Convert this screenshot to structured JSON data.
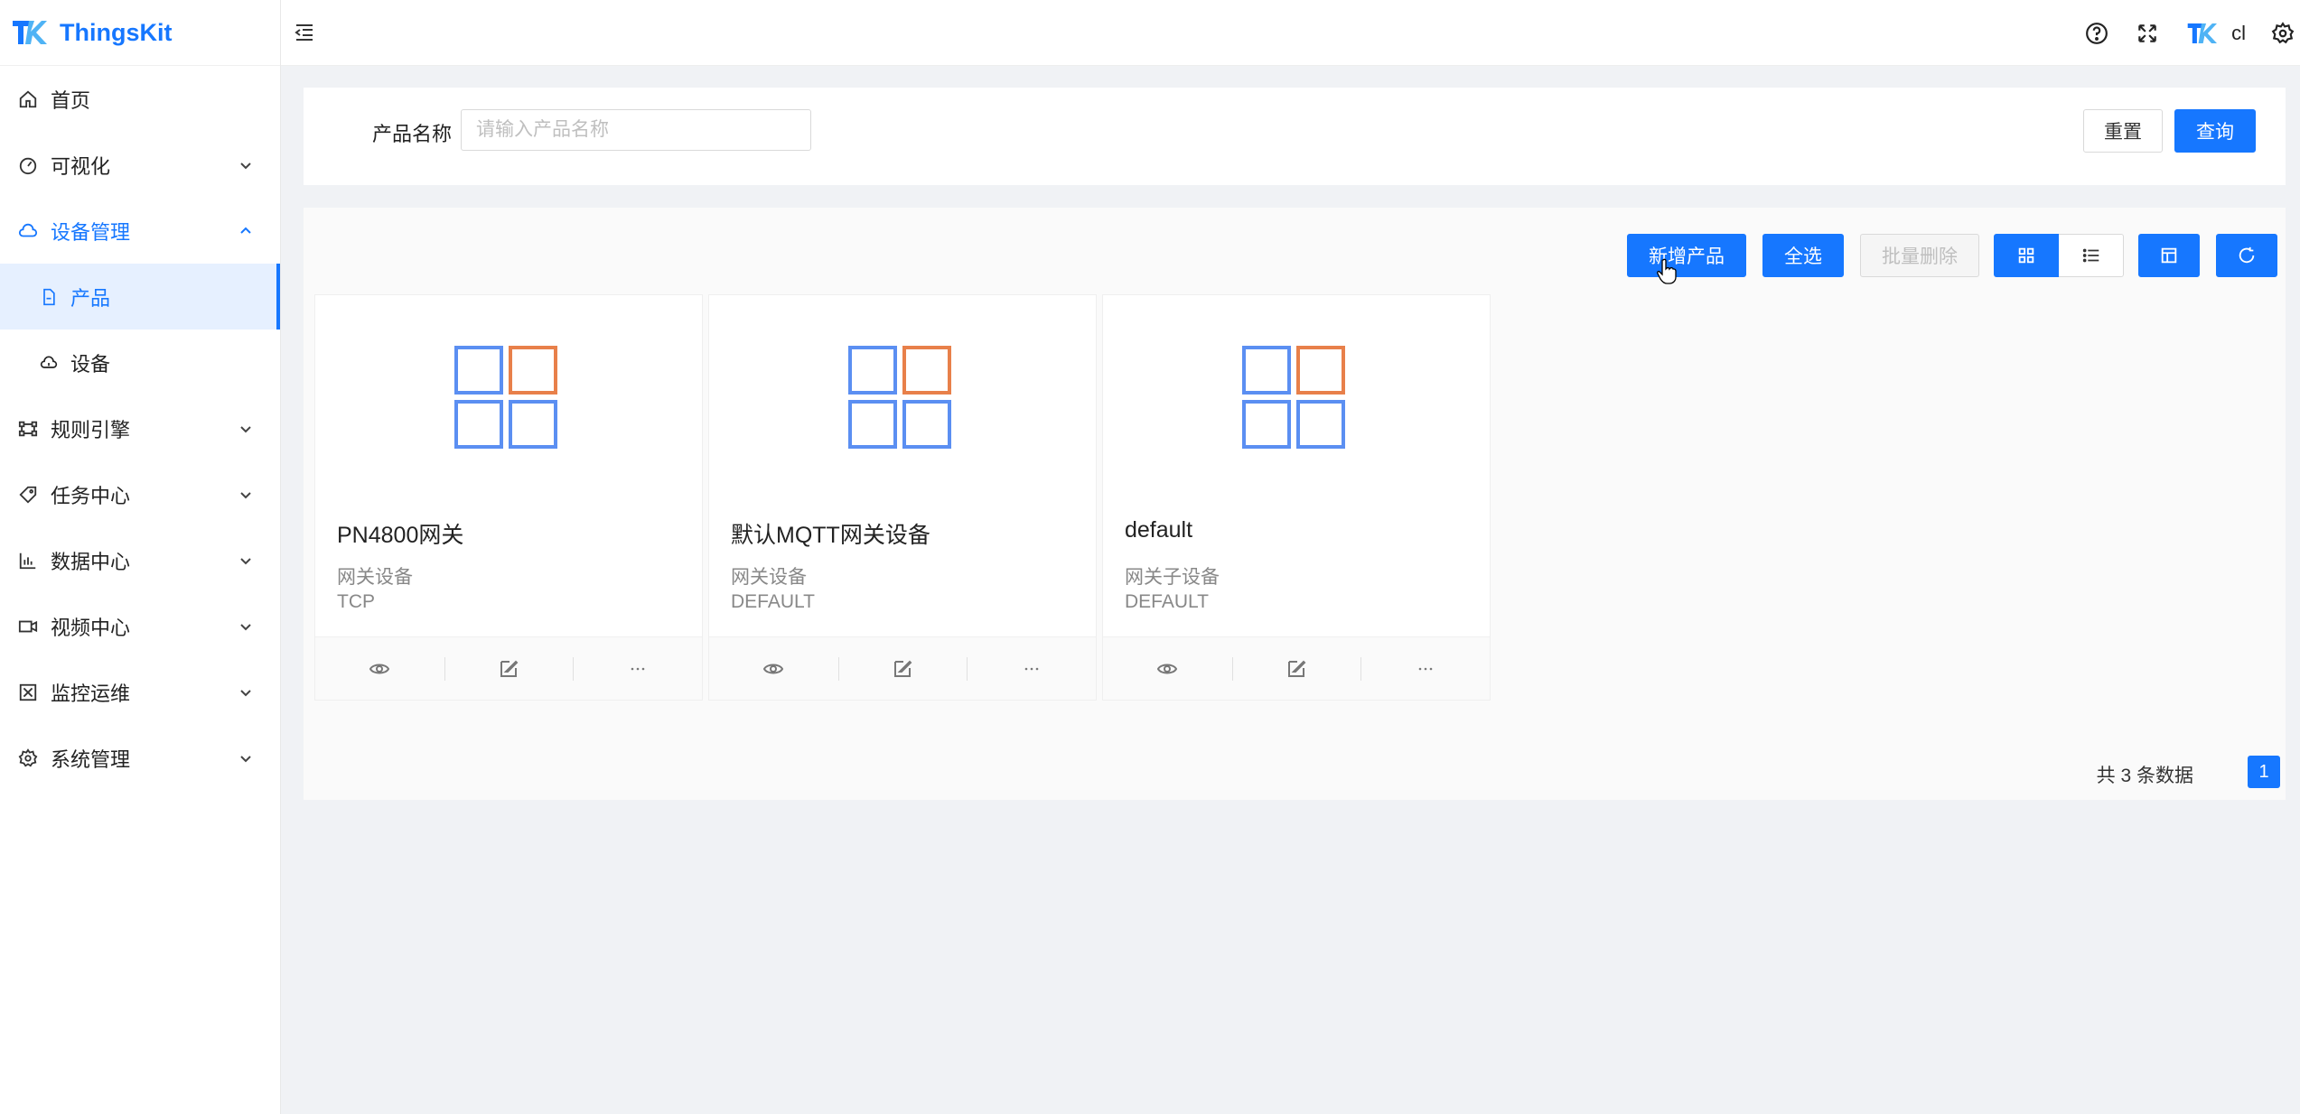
{
  "app": {
    "name": "ThingsKit"
  },
  "sidebar": {
    "items": [
      {
        "label": "首页",
        "icon": "home-icon"
      },
      {
        "label": "可视化",
        "icon": "dashboard-icon"
      },
      {
        "label": "设备管理",
        "icon": "cloud-icon",
        "expanded": true,
        "children": [
          {
            "label": "产品",
            "icon": "file-icon",
            "selected": true
          },
          {
            "label": "设备",
            "icon": "cloud-device-icon"
          }
        ]
      },
      {
        "label": "规则引擎",
        "icon": "flow-icon"
      },
      {
        "label": "任务中心",
        "icon": "tag-icon"
      },
      {
        "label": "数据中心",
        "icon": "bar-chart-icon"
      },
      {
        "label": "视频中心",
        "icon": "video-icon"
      },
      {
        "label": "监控运维",
        "icon": "monitor-icon"
      },
      {
        "label": "系统管理",
        "icon": "gear-icon"
      }
    ]
  },
  "header": {
    "username": "cl"
  },
  "search": {
    "label": "产品名称",
    "placeholder": "请输入产品名称",
    "value": "",
    "reset_label": "重置",
    "query_label": "查询"
  },
  "toolbar": {
    "add_label": "新增产品",
    "select_all_label": "全选",
    "batch_delete_label": "批量删除"
  },
  "products": [
    {
      "name": "PN4800网关",
      "type": "网关设备",
      "protocol": "TCP"
    },
    {
      "name": "默认MQTT网关设备",
      "type": "网关设备",
      "protocol": "DEFAULT"
    },
    {
      "name": "default",
      "type": "网关子设备",
      "protocol": "DEFAULT"
    }
  ],
  "pagination": {
    "total_text": "共 3 条数据",
    "current_page": "1"
  },
  "colors": {
    "primary": "#1677ff",
    "orange": "#e8804a"
  }
}
